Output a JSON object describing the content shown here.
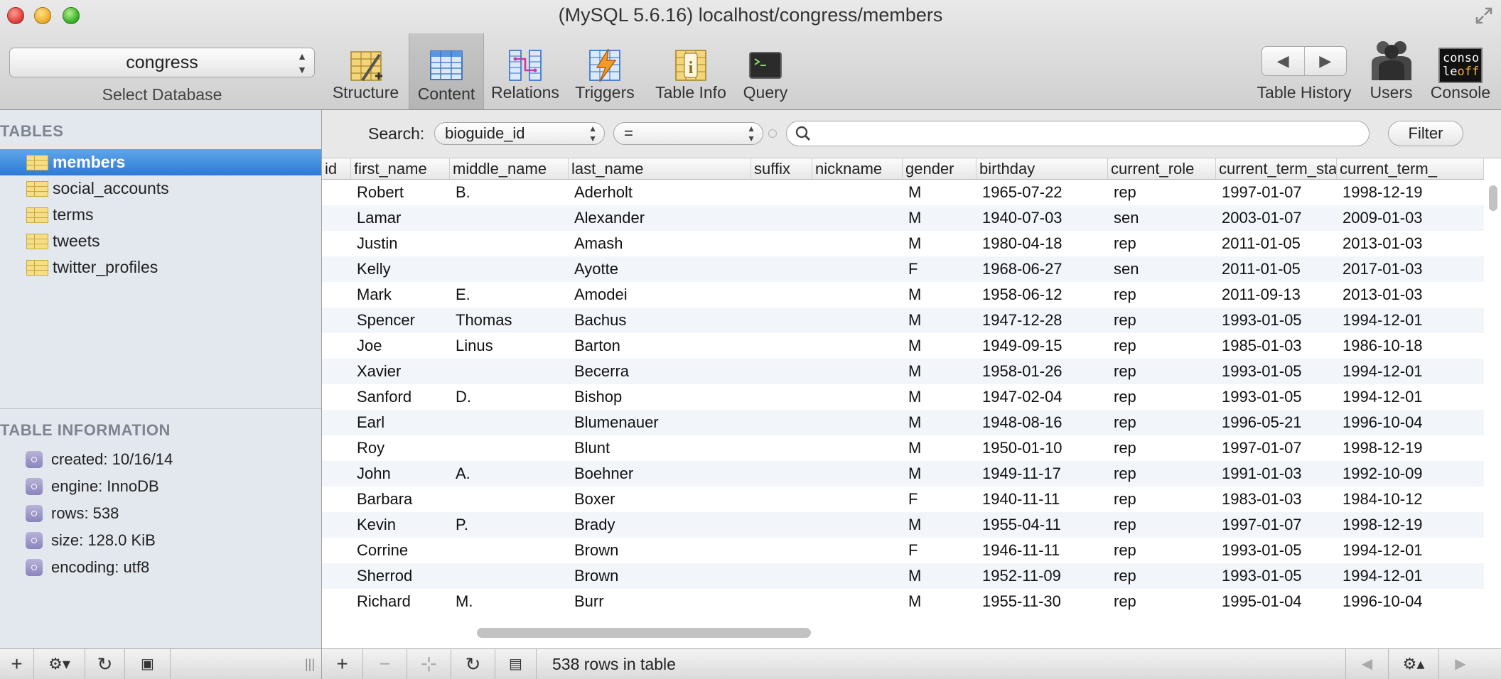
{
  "window": {
    "title": "(MySQL 5.6.16) localhost/congress/members"
  },
  "toolbar": {
    "database": "congress",
    "database_label": "Select Database",
    "structure": "Structure",
    "content": "Content",
    "relations": "Relations",
    "triggers": "Triggers",
    "table_info": "Table Info",
    "query": "Query",
    "table_history": "Table History",
    "users": "Users",
    "console": "Console",
    "console_icon_text_1": "conso",
    "console_icon_text_2": "le",
    "console_icon_text_3": "off"
  },
  "sidebar": {
    "tables_header": "TABLES",
    "tables": [
      "members",
      "social_accounts",
      "terms",
      "tweets",
      "twitter_profiles"
    ],
    "info_header": "TABLE INFORMATION",
    "info": [
      "created: 10/16/14",
      "engine: InnoDB",
      "rows: 538",
      "size: 128.0 KiB",
      "encoding: utf8"
    ]
  },
  "search": {
    "label": "Search:",
    "field": "bioguide_id",
    "operator": "=",
    "value": "",
    "filter": "Filter"
  },
  "grid": {
    "columns": [
      "id",
      "first_name",
      "middle_name",
      "last_name",
      "suffix",
      "nickname",
      "gender",
      "birthday",
      "current_role",
      "current_term_start",
      "current_term_"
    ],
    "rows": [
      [
        "",
        "Robert",
        "B.",
        "Aderholt",
        "",
        "",
        "M",
        "1965-07-22",
        "rep",
        "1997-01-07",
        "1998-12-19"
      ],
      [
        "",
        "Lamar",
        "",
        "Alexander",
        "",
        "",
        "M",
        "1940-07-03",
        "sen",
        "2003-01-07",
        "2009-01-03"
      ],
      [
        "",
        "Justin",
        "",
        "Amash",
        "",
        "",
        "M",
        "1980-04-18",
        "rep",
        "2011-01-05",
        "2013-01-03"
      ],
      [
        "",
        "Kelly",
        "",
        "Ayotte",
        "",
        "",
        "F",
        "1968-06-27",
        "sen",
        "2011-01-05",
        "2017-01-03"
      ],
      [
        "",
        "Mark",
        "E.",
        "Amodei",
        "",
        "",
        "M",
        "1958-06-12",
        "rep",
        "2011-09-13",
        "2013-01-03"
      ],
      [
        "",
        "Spencer",
        "Thomas",
        "Bachus",
        "",
        "",
        "M",
        "1947-12-28",
        "rep",
        "1993-01-05",
        "1994-12-01"
      ],
      [
        "",
        "Joe",
        "Linus",
        "Barton",
        "",
        "",
        "M",
        "1949-09-15",
        "rep",
        "1985-01-03",
        "1986-10-18"
      ],
      [
        "",
        "Xavier",
        "",
        "Becerra",
        "",
        "",
        "M",
        "1958-01-26",
        "rep",
        "1993-01-05",
        "1994-12-01"
      ],
      [
        "",
        "Sanford",
        "D.",
        "Bishop",
        "",
        "",
        "M",
        "1947-02-04",
        "rep",
        "1993-01-05",
        "1994-12-01"
      ],
      [
        "",
        "Earl",
        "",
        "Blumenauer",
        "",
        "",
        "M",
        "1948-08-16",
        "rep",
        "1996-05-21",
        "1996-10-04"
      ],
      [
        "",
        "Roy",
        "",
        "Blunt",
        "",
        "",
        "M",
        "1950-01-10",
        "rep",
        "1997-01-07",
        "1998-12-19"
      ],
      [
        "",
        "John",
        "A.",
        "Boehner",
        "",
        "",
        "M",
        "1949-11-17",
        "rep",
        "1991-01-03",
        "1992-10-09"
      ],
      [
        "",
        "Barbara",
        "",
        "Boxer",
        "",
        "",
        "F",
        "1940-11-11",
        "rep",
        "1983-01-03",
        "1984-10-12"
      ],
      [
        "",
        "Kevin",
        "P.",
        "Brady",
        "",
        "",
        "M",
        "1955-04-11",
        "rep",
        "1997-01-07",
        "1998-12-19"
      ],
      [
        "",
        "Corrine",
        "",
        "Brown",
        "",
        "",
        "F",
        "1946-11-11",
        "rep",
        "1993-01-05",
        "1994-12-01"
      ],
      [
        "",
        "Sherrod",
        "",
        "Brown",
        "",
        "",
        "M",
        "1952-11-09",
        "rep",
        "1993-01-05",
        "1994-12-01"
      ],
      [
        "",
        "Richard",
        "M.",
        "Burr",
        "",
        "",
        "M",
        "1955-11-30",
        "rep",
        "1995-01-04",
        "1996-10-04"
      ]
    ]
  },
  "status": {
    "text": "538 rows in table"
  }
}
